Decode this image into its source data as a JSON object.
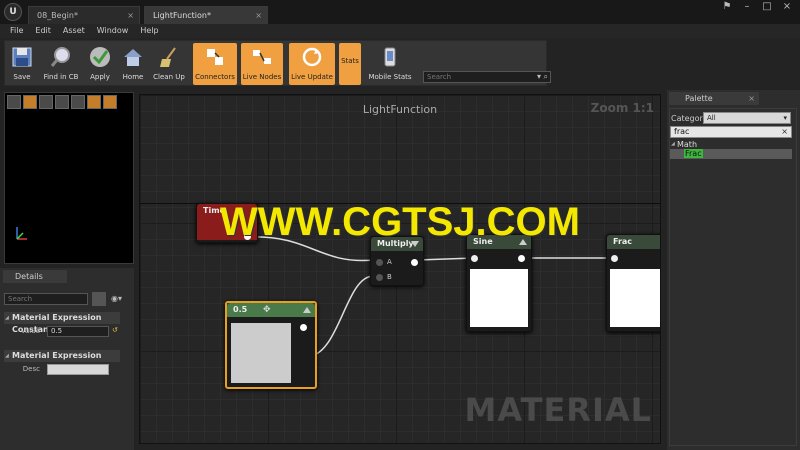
{
  "window": {
    "tabs": [
      {
        "label": "08_Begin*"
      },
      {
        "label": "LightFunction*"
      }
    ]
  },
  "menu": [
    "File",
    "Edit",
    "Asset",
    "Window",
    "Help"
  ],
  "toolbar": {
    "buttons": [
      {
        "label": "Save",
        "icon": "save-icon"
      },
      {
        "label": "Find in CB",
        "icon": "magnifier-icon"
      },
      {
        "label": "Apply",
        "icon": "checkmark-icon"
      },
      {
        "label": "Home",
        "icon": "home-icon"
      },
      {
        "label": "Clean Up",
        "icon": "broom-icon"
      },
      {
        "label": "Connectors",
        "icon": "connectors-icon",
        "toggled": true
      },
      {
        "label": "Live Nodes",
        "icon": "live-nodes-icon",
        "toggled": true
      },
      {
        "label": "Live Update",
        "icon": "live-update-icon",
        "toggled": true
      },
      {
        "label": "Stats",
        "icon": "stats-icon",
        "toggled": true
      },
      {
        "label": "Mobile Stats",
        "icon": "mobile-stats-icon"
      }
    ],
    "search_placeholder": "Search"
  },
  "details": {
    "tab_label": "Details",
    "search_placeholder": "Search",
    "categories": [
      {
        "title": "Material Expression Constant",
        "props": [
          {
            "label": "Value",
            "value": "0.5"
          }
        ]
      },
      {
        "title": "Material Expression",
        "props": [
          {
            "label": "Desc",
            "value": ""
          }
        ]
      }
    ]
  },
  "graph": {
    "title": "LightFunction",
    "zoom": "Zoom 1:1",
    "watermark": "MATERIAL",
    "nodes": {
      "time": {
        "title": "Time"
      },
      "multiply": {
        "title": "Multiply",
        "pin_a": "A",
        "pin_b": "B"
      },
      "sine": {
        "title": "Sine"
      },
      "frac": {
        "title": "Frac"
      },
      "constant": {
        "title": "0.5"
      }
    }
  },
  "palette": {
    "tab_label": "Palette",
    "category_label": "Category:",
    "category_value": "All",
    "search_value": "frac",
    "group": "Math",
    "item": "Frac"
  },
  "overlay": "WWW.CGTSJ.COM",
  "colors": {
    "accent_orange": "#f0a040",
    "time_header": "#8a1c1c",
    "multiply_header": "#3a4a3a",
    "palette_highlight": "#3cb63c",
    "overlay_text": "#f5e800"
  }
}
